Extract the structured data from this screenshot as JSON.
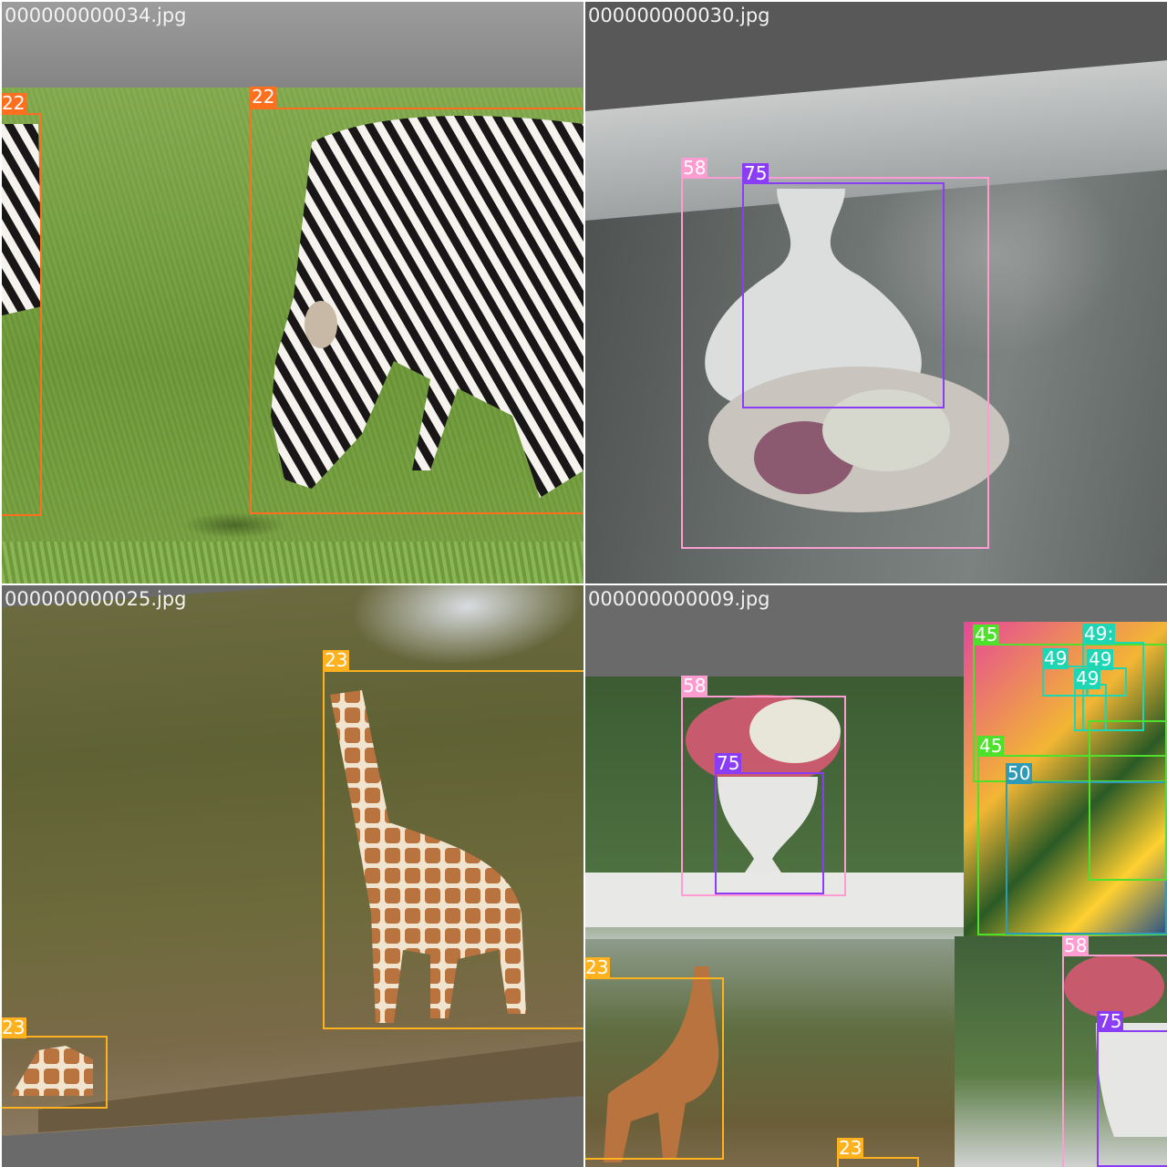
{
  "tiles": [
    {
      "filename": "000000000034.jpg",
      "labels": [
        "22",
        "22"
      ]
    },
    {
      "filename": "000000000030.jpg",
      "labels": [
        "58",
        "75"
      ]
    },
    {
      "filename": "000000000025.jpg",
      "labels": [
        "23",
        "23"
      ]
    },
    {
      "filename": "000000000009.jpg",
      "labels": [
        "45",
        "49:",
        "49",
        "49",
        "49",
        "45",
        "50",
        "58",
        "75",
        "23",
        "23",
        "58",
        "75"
      ]
    }
  ],
  "colors": {
    "class_22": "#ff6f1e",
    "class_23": "#ffb21d",
    "class_45": "#4ee02b",
    "class_49": "#1ed6b4",
    "class_50": "#2f9bb6",
    "class_58": "#ff9cd2",
    "class_75": "#8a3df5"
  }
}
